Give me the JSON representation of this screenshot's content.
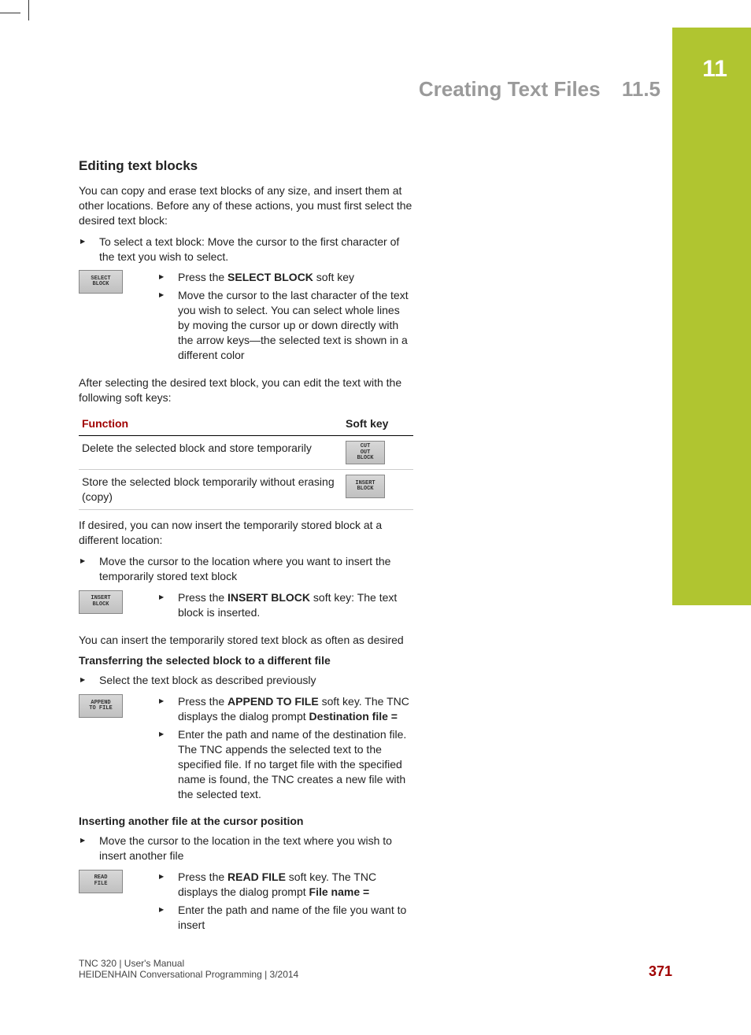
{
  "header": {
    "title": "Creating Text Files",
    "section": "11.5",
    "chapter": "11"
  },
  "sec_title": "Editing text blocks",
  "intro": "You can copy and erase text blocks of any size, and insert them at other locations. Before any of these actions, you must first select the desired text block:",
  "bul1": "To select a text block: Move the cursor to the first character of the text you wish to select.",
  "key_select": {
    "line1": "SELECT",
    "line2": "BLOCK"
  },
  "sel_a_pre": "Press the ",
  "sel_a_bold": "SELECT BLOCK",
  "sel_a_post": " soft key",
  "sel_b": "Move the cursor to the last character of the text you wish to select. You can select whole lines by moving the cursor up or down directly with the arrow keys—the selected text is shown in a different color",
  "after_sel": "After selecting the desired text block, you can edit the text with the following soft keys:",
  "tbl": {
    "h1": "Function",
    "h2": "Soft key",
    "r1_f": "Delete the selected block and store temporarily",
    "r1_k": {
      "l1": "CUT",
      "l2": "OUT",
      "l3": "BLOCK"
    },
    "r2_f": "Store the selected block temporarily without erasing (copy)",
    "r2_k": {
      "l1": "INSERT",
      "l2": "BLOCK"
    }
  },
  "after_tbl": "If desired, you can now insert the temporarily stored block at a different location:",
  "bul2": "Move the cursor to the location where you want to insert the temporarily stored text block",
  "key_insert": {
    "l1": "INSERT",
    "l2": "BLOCK"
  },
  "ins_a_pre": "Press the ",
  "ins_a_bold": "INSERT BLOCK",
  "ins_a_post": " soft key: The text block is inserted.",
  "often": "You can insert the temporarily stored text block as often as desired",
  "sub1": "Transferring the selected block to a different file",
  "bul3": "Select the text block as described previously",
  "key_append": {
    "l1": "APPEND",
    "l2": "TO FILE"
  },
  "app_a_pre": "Press the ",
  "app_a_bold": "APPEND TO FILE",
  "app_a_mid": " soft key. The TNC displays the dialog prompt ",
  "app_a_bold2": "Destination file =",
  "app_b": "Enter the path and name of the destination file. The TNC appends the selected text to the specified file. If no target file with the specified name is found, the TNC creates a new file with the selected text.",
  "sub2": "Inserting another file at the cursor position",
  "bul4": "Move the cursor to the location in the text where you wish to insert another file",
  "key_read": {
    "l1": "READ",
    "l2": "FILE"
  },
  "rd_a_pre": "Press the ",
  "rd_a_bold": "READ FILE",
  "rd_a_mid": " soft key. The TNC displays the dialog prompt ",
  "rd_a_bold2": "File name =",
  "rd_b": "Enter the path and name of the file you want to insert",
  "footer": {
    "line1": "TNC 320 | User's Manual",
    "line2": "HEIDENHAIN Conversational Programming | 3/2014",
    "page": "371"
  }
}
